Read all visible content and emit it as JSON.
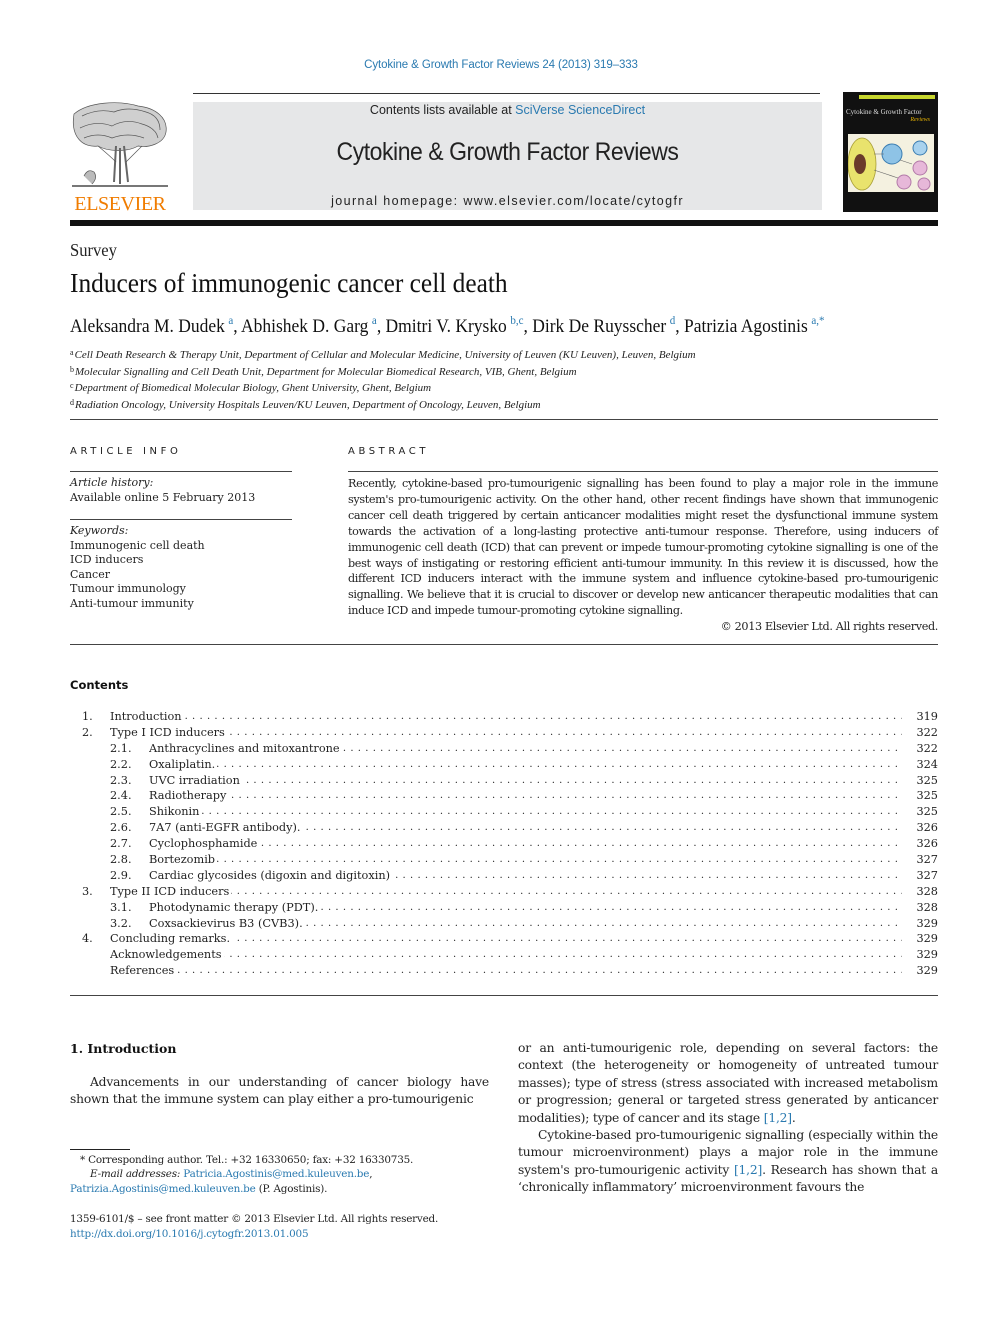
{
  "header": {
    "citation": "Cytokine & Growth Factor Reviews 24 (2013) 319–333",
    "publisher_logo_text": "ELSEVIER",
    "contents_prefix": "Contents lists available at ",
    "contents_link": "SciVerse ScienceDirect",
    "journal_title": "Cytokine & Growth Factor Reviews",
    "homepage_label": "journal homepage: www.elsevier.com/locate/cytogfr",
    "cover_title": "Cytokine & Growth Factor",
    "cover_subtitle": "Reviews",
    "brand_orange": "#f07c00",
    "link_blue": "#2a7ab0"
  },
  "article": {
    "type": "Survey",
    "title": "Inducers of immunogenic cancer cell death",
    "authors": [
      {
        "name": "Aleksandra M. Dudek",
        "sup": "a"
      },
      {
        "name": "Abhishek D. Garg",
        "sup": "a"
      },
      {
        "name": "Dmitri V. Krysko",
        "sup": "b,c"
      },
      {
        "name": "Dirk De Ruysscher",
        "sup": "d"
      },
      {
        "name": "Patrizia Agostinis",
        "sup": "a,*"
      }
    ],
    "affiliations": [
      {
        "key": "a",
        "text": "Cell Death Research & Therapy Unit, Department of Cellular and Molecular Medicine, University of Leuven (KU Leuven), Leuven, Belgium"
      },
      {
        "key": "b",
        "text": "Molecular Signalling and Cell Death Unit, Department for Molecular Biomedical Research, VIB, Ghent, Belgium"
      },
      {
        "key": "c",
        "text": "Department of Biomedical Molecular Biology, Ghent University, Ghent, Belgium"
      },
      {
        "key": "d",
        "text": "Radiation Oncology, University Hospitals Leuven/KU Leuven, Department of Oncology, Leuven, Belgium"
      }
    ]
  },
  "article_info": {
    "heading": "ARTICLE INFO",
    "history_label": "Article history:",
    "history_value": "Available online 5 February 2013",
    "keywords_label": "Keywords:",
    "keywords": [
      "Immunogenic cell death",
      "ICD inducers",
      "Cancer",
      "Tumour immunology",
      "Anti-tumour immunity"
    ]
  },
  "abstract": {
    "heading": "ABSTRACT",
    "text": "Recently, cytokine-based pro-tumourigenic signalling has been found to play a major role in the immune system's pro-tumourigenic activity. On the other hand, other recent findings have shown that immunogenic cancer cell death triggered by certain anticancer modalities might reset the dysfunctional immune system towards the activation of a long-lasting protective anti-tumour response. Therefore, using inducers of immunogenic cell death (ICD) that can prevent or impede tumour-promoting cytokine signalling is one of the best ways of instigating or restoring efficient anti-tumour immunity. In this review it is discussed, how the different ICD inducers interact with the immune system and influence cytokine-based pro-tumourigenic signalling. We believe that it is crucial to discover or develop new anticancer therapeutic modalities that can induce ICD and impede tumour-promoting cytokine signalling.",
    "copyright": "© 2013 Elsevier Ltd. All rights reserved."
  },
  "contents": {
    "heading": "Contents",
    "items": [
      {
        "num": "1.",
        "label": "Introduction",
        "page": "319",
        "level": 1
      },
      {
        "num": "2.",
        "label": "Type I ICD inducers",
        "page": "322",
        "level": 1
      },
      {
        "num": "2.1.",
        "label": "Anthracyclines and mitoxantrone",
        "page": "322",
        "level": 2
      },
      {
        "num": "2.2.",
        "label": "Oxaliplatin.",
        "page": "324",
        "level": 2
      },
      {
        "num": "2.3.",
        "label": "UVC irradiation",
        "page": "325",
        "level": 2
      },
      {
        "num": "2.4.",
        "label": "Radiotherapy",
        "page": "325",
        "level": 2
      },
      {
        "num": "2.5.",
        "label": "Shikonin",
        "page": "325",
        "level": 2
      },
      {
        "num": "2.6.",
        "label": "7A7 (anti-EGFR antibody).",
        "page": "326",
        "level": 2
      },
      {
        "num": "2.7.",
        "label": "Cyclophosphamide",
        "page": "326",
        "level": 2
      },
      {
        "num": "2.8.",
        "label": "Bortezomib",
        "page": "327",
        "level": 2
      },
      {
        "num": "2.9.",
        "label": "Cardiac glycosides (digoxin and digitoxin)",
        "page": "327",
        "level": 2
      },
      {
        "num": "3.",
        "label": "Type II ICD inducers",
        "page": "328",
        "level": 1
      },
      {
        "num": "3.1.",
        "label": "Photodynamic therapy (PDT).",
        "page": "328",
        "level": 2
      },
      {
        "num": "3.2.",
        "label": "Coxsackievirus B3 (CVB3).",
        "page": "329",
        "level": 2
      },
      {
        "num": "4.",
        "label": "Concluding remarks.",
        "page": "329",
        "level": 1
      },
      {
        "num": "",
        "label": "Acknowledgements",
        "page": "329",
        "level": 1
      },
      {
        "num": "",
        "label": "References",
        "page": "329",
        "level": 1
      }
    ]
  },
  "introduction": {
    "heading": "1.  Introduction",
    "left_text": "Advancements in our understanding of cancer biology have shown that the immune system can play either a pro-tumourigenic",
    "right_p1_text": "or an anti-tumourigenic role, depending on several factors: the context (the heterogeneity or homogeneity of untreated tumour masses); type of stress (stress associated with increased metabolism or progression; general or targeted stress generated by anticancer modalities); type of cancer and its stage ",
    "right_p1_ref": "[1,2]",
    "right_p1_end": ".",
    "right_p2_text": "Cytokine-based pro-tumourigenic signalling (especially within the tumour microenvironment) plays a major role in the immune system's pro-tumourigenic activity ",
    "right_p2_ref": "[1,2]",
    "right_p2_end": ". Research has shown that a ‘chronically inflammatory’ microenvironment favours the"
  },
  "footnotes": {
    "corresponding": "* Corresponding author. Tel.: +32 16330650; fax: +32 16330735.",
    "email_label": "E-mail addresses:",
    "email1": "Patricia.Agostinis@med.kuleuven.be",
    "email2": "Patrizia.Agostinis@med.kuleuven.be",
    "email2_suffix": " (P. Agostinis).",
    "issn": "1359-6101/$ – see front matter © 2013 Elsevier Ltd. All rights reserved.",
    "doi": "http://dx.doi.org/10.1016/j.cytogfr.2013.01.005"
  }
}
